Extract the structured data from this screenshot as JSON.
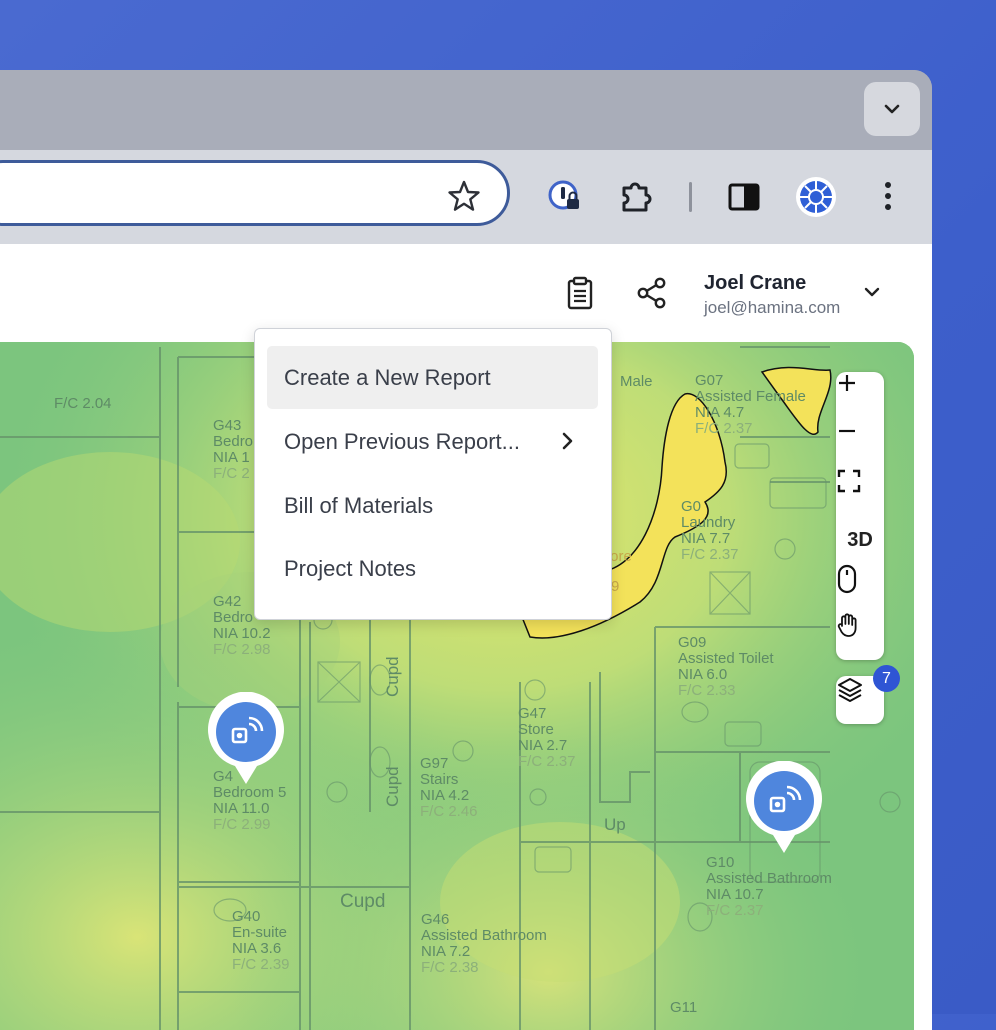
{
  "browser": {
    "tab_dropdown_icon": "chevron-down-icon",
    "bookmark_icon": "star-icon",
    "toolbar_icons": [
      "password-manager-icon",
      "extensions-icon",
      "side-panel-icon",
      "profile-icon",
      "more-vert-icon"
    ]
  },
  "header": {
    "report_icon": "clipboard-icon",
    "share_icon": "share-icon",
    "user_name": "Joel Crane",
    "user_email": "joel@hamina.com"
  },
  "menu": {
    "items": [
      {
        "label": "Create a New Report",
        "active": true
      },
      {
        "label": "Open Previous Report...",
        "submenu": true
      },
      {
        "label": "Bill of Materials"
      },
      {
        "label": "Project Notes"
      }
    ]
  },
  "map_controls": {
    "zoom_in": "+",
    "zoom_out": "−",
    "fullscreen_icon": "fullscreen-icon",
    "view3d": "3D",
    "mouse_icon": "mouse-icon",
    "hand_icon": "hand-icon",
    "layers_icon": "layers-icon",
    "layers_count": "7"
  },
  "floorplan": {
    "labels": [
      {
        "text": "F/C 2.04"
      },
      {
        "text": "G43"
      },
      {
        "text": "Bedro"
      },
      {
        "text": "NIA 1"
      },
      {
        "text": "F/C 2"
      },
      {
        "text": "G42"
      },
      {
        "text": "Bedro"
      },
      {
        "text": "NIA 10.2"
      },
      {
        "text": "F/C 2.98"
      },
      {
        "text": "G4"
      },
      {
        "text": "Bedroom 5"
      },
      {
        "text": "NIA 11.0"
      },
      {
        "text": "F/C 2.99"
      },
      {
        "text": "G40"
      },
      {
        "text": "En-suite"
      },
      {
        "text": "NIA 3.6"
      },
      {
        "text": "F/C 2.39"
      },
      {
        "text": "G97"
      },
      {
        "text": "Stairs"
      },
      {
        "text": "NIA 4.2"
      },
      {
        "text": "F/C 2.46"
      },
      {
        "text": "G47"
      },
      {
        "text": "Store"
      },
      {
        "text": "NIA 2.7"
      },
      {
        "text": "F/C 2.37"
      },
      {
        "text": "G46"
      },
      {
        "text": "Assisted Bathroom"
      },
      {
        "text": "NIA 7.2"
      },
      {
        "text": "F/C 2.38"
      },
      {
        "text": "G07"
      },
      {
        "text": "Assisted Female"
      },
      {
        "text": "NIA 4.7"
      },
      {
        "text": "F/C 2.37"
      },
      {
        "text": "Male"
      },
      {
        "text": "G0"
      },
      {
        "text": "Laundry"
      },
      {
        "text": "NIA 7.7"
      },
      {
        "text": "F/C 2.37"
      },
      {
        "text": "tore"
      },
      {
        "text": "9"
      },
      {
        "text": "G09"
      },
      {
        "text": "Assisted Toilet"
      },
      {
        "text": "NIA 6.0"
      },
      {
        "text": "F/C 2.33"
      },
      {
        "text": "G10"
      },
      {
        "text": "Assisted Bathroom"
      },
      {
        "text": "NIA 10.7"
      },
      {
        "text": "F/C 2.37"
      },
      {
        "text": "G11"
      },
      {
        "text": "Cupd"
      },
      {
        "text": "Cupd"
      },
      {
        "text": "Cupd"
      },
      {
        "text": "Up"
      }
    ]
  },
  "access_points": [
    {
      "icon": "access-point-icon"
    },
    {
      "icon": "access-point-icon"
    }
  ]
}
